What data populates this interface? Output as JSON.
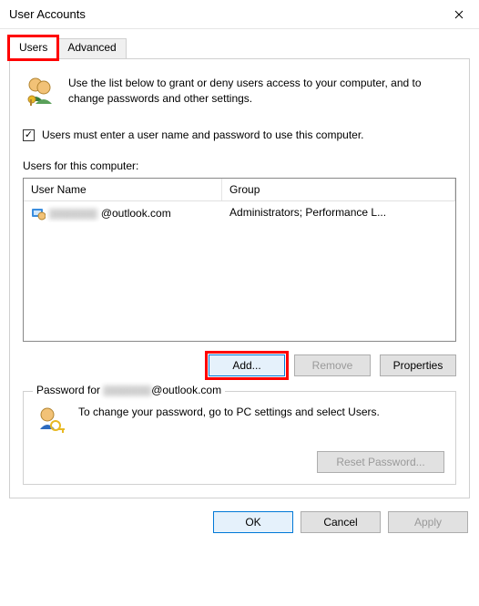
{
  "window": {
    "title": "User Accounts"
  },
  "tabs": {
    "users": "Users",
    "advanced": "Advanced"
  },
  "intro": "Use the list below to grant or deny users access to your computer, and to change passwords and other settings.",
  "checkbox": {
    "label": "Users must enter a user name and password to use this computer.",
    "checked": "✓"
  },
  "list": {
    "label": "Users for this computer:",
    "headers": {
      "user": "User Name",
      "group": "Group"
    },
    "rows": [
      {
        "user_masked": "▯▯▯▯▯▯▯▯",
        "user_suffix": "@outlook.com",
        "group": "Administrators; Performance L..."
      }
    ]
  },
  "buttons": {
    "add": "Add...",
    "remove": "Remove",
    "properties": "Properties"
  },
  "password_group": {
    "title_prefix": "Password for ",
    "title_masked": "▯▯▯▯▯▯▯▯",
    "title_suffix": "@outlook.com",
    "text": "To change your password, go to PC settings and select Users.",
    "reset": "Reset Password..."
  },
  "footer": {
    "ok": "OK",
    "cancel": "Cancel",
    "apply": "Apply"
  }
}
